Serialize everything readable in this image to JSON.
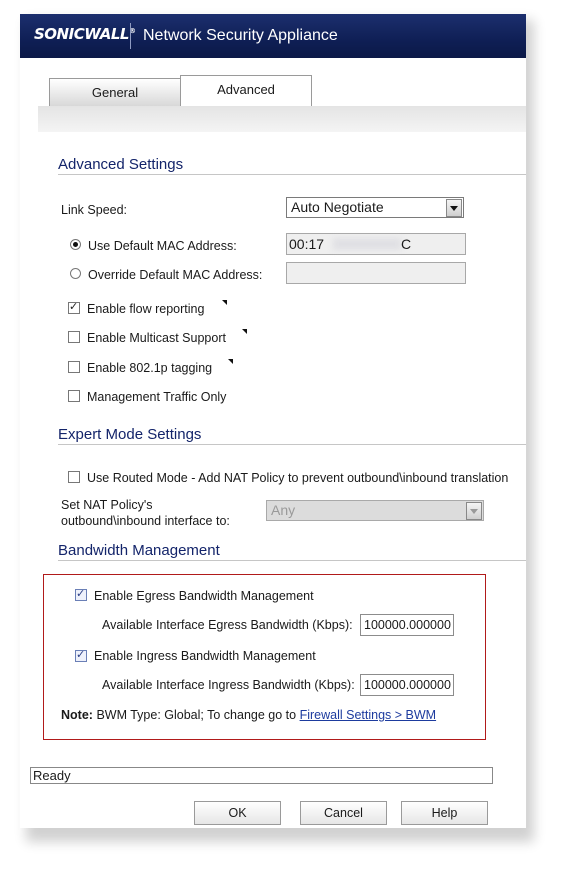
{
  "header": {
    "logo": "SONICWALL",
    "title": "Network Security Appliance"
  },
  "tabs": [
    {
      "label": "General"
    },
    {
      "label": "Advanced"
    }
  ],
  "advanced_settings": {
    "title": "Advanced Settings",
    "link_speed_label": "Link Speed:",
    "link_speed_value": "Auto Negotiate",
    "use_default_mac_label": "Use Default MAC Address:",
    "use_default_mac_value_start": "00:17",
    "use_default_mac_value_end": "C",
    "override_mac_label": "Override Default MAC Address:",
    "override_mac_value": "",
    "flow_reporting_label": "Enable flow reporting",
    "multicast_label": "Enable Multicast Support",
    "tagging_label": "Enable 802.1p tagging",
    "mgmt_traffic_label": "Management Traffic Only"
  },
  "expert_mode": {
    "title": "Expert Mode Settings",
    "routed_mode_label": "Use Routed Mode - Add NAT Policy to prevent outbound\\inbound translation",
    "nat_policy_label_line1": "Set NAT Policy's",
    "nat_policy_label_line2": "outbound\\inbound interface to:",
    "nat_policy_value": "Any"
  },
  "bandwidth": {
    "title": "Bandwidth Management",
    "egress_label": "Enable Egress Bandwidth Management",
    "egress_bw_label": "Available Interface Egress Bandwidth (Kbps):",
    "egress_bw_value": "100000.000000",
    "ingress_label": "Enable Ingress Bandwidth Management",
    "ingress_bw_label": "Available Interface Ingress Bandwidth (Kbps):",
    "ingress_bw_value": "100000.000000",
    "note_bold": "Note:",
    "note_text": "BWM Type: Global; To change go to",
    "note_link": "Firewall Settings > BWM"
  },
  "status": {
    "text": "Ready"
  },
  "buttons": {
    "ok": "OK",
    "cancel": "Cancel",
    "help": "Help"
  },
  "colors": {
    "header": "#0f1f55",
    "section_title": "#13246a",
    "highlight_box": "#b11a1a",
    "link": "#1d3b9e"
  }
}
